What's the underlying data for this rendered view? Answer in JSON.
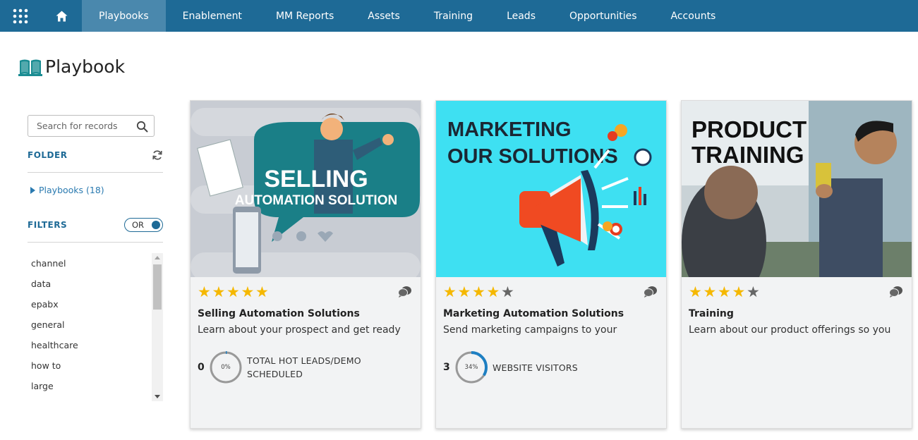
{
  "nav": {
    "tabs": [
      {
        "label": "Playbooks",
        "active": true
      },
      {
        "label": "Enablement"
      },
      {
        "label": "MM Reports"
      },
      {
        "label": "Assets"
      },
      {
        "label": "Training"
      },
      {
        "label": "Leads"
      },
      {
        "label": "Opportunities"
      },
      {
        "label": "Accounts"
      }
    ],
    "icons": [
      "app-grid-icon",
      "home-icon"
    ],
    "bg_color": "#1e6a96",
    "active_color": "#4a88ad"
  },
  "page": {
    "title": "Playbook",
    "icon": "book-icon"
  },
  "sidebar": {
    "search_placeholder": "Search for records",
    "folder_label": "FOLDER",
    "folder_item": "Playbooks (18)",
    "filters_label": "FILTERS",
    "toggle_label": "OR",
    "filters": [
      "channel",
      "data",
      "epabx",
      "general",
      "healthcare",
      "how to",
      "large"
    ]
  },
  "cards": [
    {
      "image_text": {
        "line1": "SELLING",
        "line2": "AUTOMATION SOLUTION"
      },
      "rating": 5,
      "title": "Selling Automation Solutions",
      "description": "Learn about your prospect and get ready",
      "metric": {
        "count": "0",
        "percent": 0,
        "percent_label": "0%",
        "label_line1": "TOTAL HOT LEADS/DEMO",
        "label_line2": "SCHEDULED"
      }
    },
    {
      "image_text": {
        "line1": "MARKETING",
        "line2": "OUR SOLUTIONS"
      },
      "rating": 4,
      "title": "Marketing Automation Solutions",
      "description": "Send marketing campaigns to your",
      "metric": {
        "count": "3",
        "percent": 34,
        "percent_label": "34%",
        "label_line1": "WEBSITE VISITORS",
        "label_line2": ""
      }
    },
    {
      "image_text": {
        "line1": "PRODUCT",
        "line2": "TRAINING"
      },
      "rating": 4,
      "title": "Training",
      "description": "Learn about our product offerings so you"
    }
  ],
  "colors": {
    "star": "#f5b800",
    "accent": "#1e6a96",
    "link": "#2a7ab0"
  }
}
